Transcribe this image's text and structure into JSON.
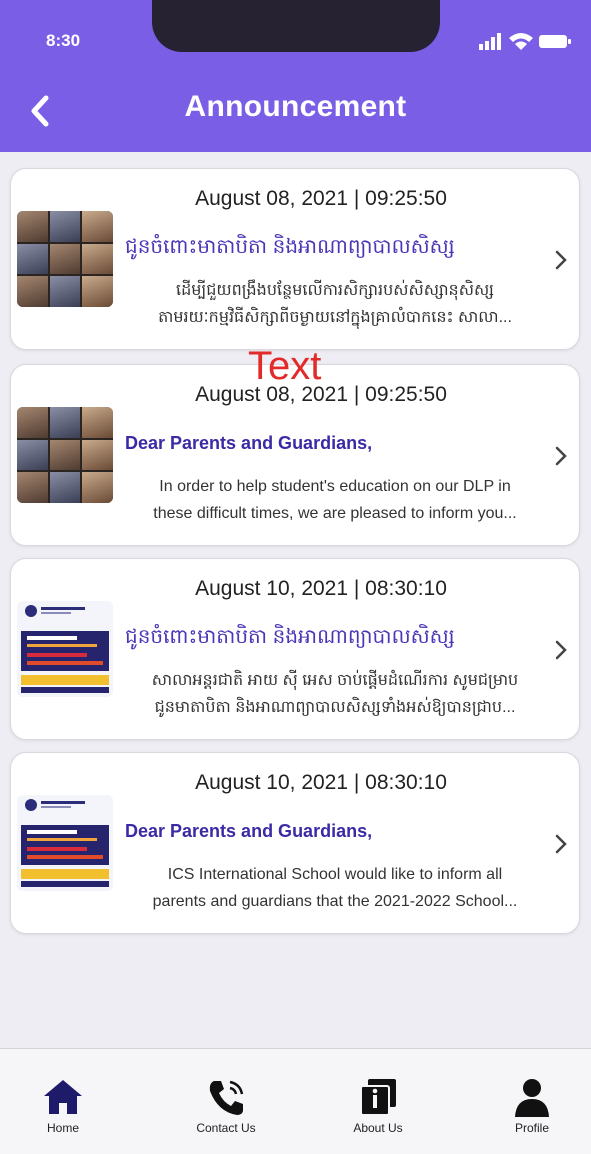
{
  "status": {
    "time": "8:30"
  },
  "header": {
    "title": "Announcement"
  },
  "overlay": {
    "text": "Text"
  },
  "announcements": [
    {
      "date": "August 08, 2021 | 09:25:50",
      "heading": "ជូនចំពោះមាតាបិតា និងអាណាព្យាបាលសិស្ស",
      "lines": [
        "ដើម្បីជួយពង្រឹងបន្ថែមលើការសិក្សារបស់សិស្សានុសិស្ស",
        "តាមរយៈកម្មវិធីសិក្សាពីចម្ងាយនៅក្នុងគ្រាលំបាកនេះ សាលា..."
      ],
      "thumb": "video-call-photo"
    },
    {
      "date": "August 08, 2021 | 09:25:50",
      "heading": "Dear Parents and Guardians,",
      "lines": [
        "In order to help student's education on our DLP in",
        "these difficult times, we are pleased to inform you..."
      ],
      "thumb": "video-call-photo"
    },
    {
      "date": "August 10, 2021 | 08:30:10",
      "heading": "ជូនចំពោះមាតាបិតា និងអាណាព្យាបាលសិស្ស",
      "lines": [
        "សាលាអន្តរជាតិ អាយ ស៊ី អេស ចាប់ផ្តើមដំណើរការ សូមជម្រាប",
        "ជូនមាតាបិតា និងអាណាព្យាបាលសិស្សទាំងអស់ឱ្យបានជ្រាប..."
      ],
      "thumb": "school-flyer"
    },
    {
      "date": "August 10, 2021 | 08:30:10",
      "heading": "Dear Parents and Guardians,",
      "lines": [
        "ICS International School would like to inform all",
        "parents and guardians that the 2021-2022 School..."
      ],
      "thumb": "school-flyer"
    }
  ],
  "nav": [
    {
      "label": "Home",
      "icon": "home-icon",
      "active": true
    },
    {
      "label": "Contact Us",
      "icon": "phone-icon",
      "active": false
    },
    {
      "label": "About Us",
      "icon": "about-icon",
      "active": false
    },
    {
      "label": "Profile",
      "icon": "profile-icon",
      "active": false
    }
  ],
  "colors": {
    "header": "#7b5ee6",
    "accent": "#3a2aa6",
    "nav_active": "#1f1b6b"
  }
}
